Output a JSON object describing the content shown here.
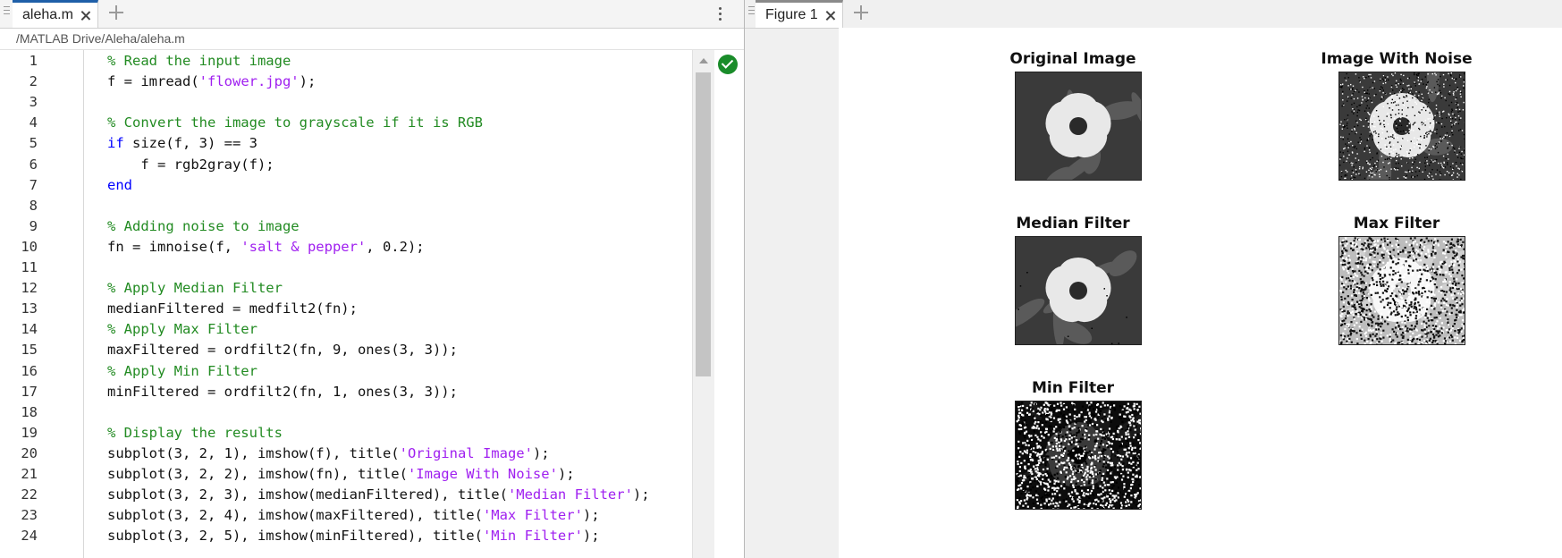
{
  "editor": {
    "tab_label": "aleha.m",
    "path": "/MATLAB Drive/Aleha/aleha.m",
    "lines": [
      [
        {
          "t": "% Read the input image",
          "c": "c"
        }
      ],
      [
        {
          "t": "f = imread(",
          "c": ""
        },
        {
          "t": "'flower.jpg'",
          "c": "s"
        },
        {
          "t": ");",
          "c": ""
        }
      ],
      [],
      [
        {
          "t": "% Convert the image to grayscale if it is RGB",
          "c": "c"
        }
      ],
      [
        {
          "t": "if",
          "c": "k"
        },
        {
          "t": " size(f, 3) == 3",
          "c": ""
        }
      ],
      [
        {
          "t": "    f = rgb2gray(f);",
          "c": ""
        }
      ],
      [
        {
          "t": "end",
          "c": "k"
        }
      ],
      [],
      [
        {
          "t": "% Adding noise to image",
          "c": "c"
        }
      ],
      [
        {
          "t": "fn = imnoise(f, ",
          "c": ""
        },
        {
          "t": "'salt & pepper'",
          "c": "s"
        },
        {
          "t": ", 0.2);",
          "c": ""
        }
      ],
      [],
      [
        {
          "t": "% Apply Median Filter",
          "c": "c"
        }
      ],
      [
        {
          "t": "medianFiltered = medfilt2(fn);",
          "c": ""
        }
      ],
      [
        {
          "t": "% Apply Max Filter",
          "c": "c"
        }
      ],
      [
        {
          "t": "maxFiltered = ordfilt2(fn, 9, ones(3, 3));",
          "c": ""
        }
      ],
      [
        {
          "t": "% Apply Min Filter",
          "c": "c"
        }
      ],
      [
        {
          "t": "minFiltered = ordfilt2(fn, 1, ones(3, 3));",
          "c": ""
        }
      ],
      [],
      [
        {
          "t": "% Display the results",
          "c": "c"
        }
      ],
      [
        {
          "t": "subplot(3, 2, 1), imshow(f), title(",
          "c": ""
        },
        {
          "t": "'Original Image'",
          "c": "s"
        },
        {
          "t": ");",
          "c": ""
        }
      ],
      [
        {
          "t": "subplot(3, 2, 2), imshow(fn), title(",
          "c": ""
        },
        {
          "t": "'Image With Noise'",
          "c": "s"
        },
        {
          "t": ");",
          "c": ""
        }
      ],
      [
        {
          "t": "subplot(3, 2, 3), imshow(medianFiltered), title(",
          "c": ""
        },
        {
          "t": "'Median Filter'",
          "c": "s"
        },
        {
          "t": ");",
          "c": ""
        }
      ],
      [
        {
          "t": "subplot(3, 2, 4), imshow(maxFiltered), title(",
          "c": ""
        },
        {
          "t": "'Max Filter'",
          "c": "s"
        },
        {
          "t": ");",
          "c": ""
        }
      ],
      [
        {
          "t": "subplot(3, 2, 5), imshow(minFiltered), title(",
          "c": ""
        },
        {
          "t": "'Min Filter'",
          "c": "s"
        },
        {
          "t": ");",
          "c": ""
        }
      ]
    ],
    "status_icon": "checkmark-circle-icon",
    "status_color": "#1a8c2a"
  },
  "figure": {
    "tab_label": "Figure 1",
    "subplots": [
      {
        "title": "Original Image",
        "style": "original"
      },
      {
        "title": "Image With Noise",
        "style": "noise"
      },
      {
        "title": "Median Filter",
        "style": "median"
      },
      {
        "title": "Max Filter",
        "style": "max"
      },
      {
        "title": "Min Filter",
        "style": "min"
      }
    ]
  },
  "colors": {
    "comment": "#228b22",
    "keyword": "#0000ff",
    "string": "#a020f0"
  }
}
